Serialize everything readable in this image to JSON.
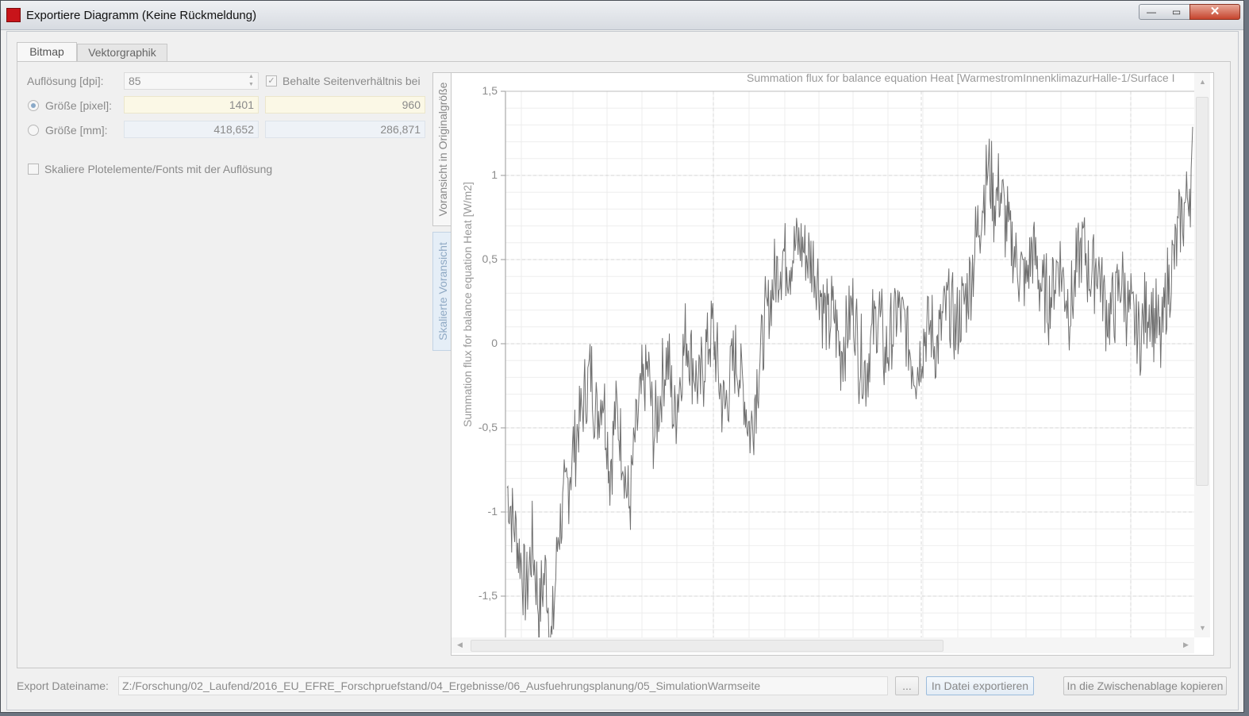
{
  "window": {
    "title": "Exportiere Diagramm (Keine Rückmeldung)",
    "controls": {
      "minimize": "—",
      "maximize": "▭",
      "close": "✕"
    }
  },
  "tabs": [
    {
      "label": "Bitmap",
      "active": true
    },
    {
      "label": "Vektorgraphik",
      "active": false
    }
  ],
  "bitmap": {
    "resolution_label": "Auflösung [dpi]:",
    "resolution_value": "85",
    "keep_aspect_label": "Behalte Seitenverhältnis bei",
    "keep_aspect_checked": true,
    "size_pixel_label": "Größe [pixel]:",
    "size_pixel_selected": true,
    "size_pixel_width": "1401",
    "size_pixel_height": "960",
    "size_mm_label": "Größe [mm]:",
    "size_mm_width": "418,652",
    "size_mm_height": "286,871",
    "scale_fonts_label": "Skaliere Plotelemente/Fonts mit der Auflösung",
    "scale_fonts_checked": false
  },
  "preview_tabs": {
    "original": "Voransicht in Originalgröße",
    "scaled": "Skalierte Voransicht"
  },
  "chart_data": {
    "type": "line",
    "title": "Summation flux for balance equation Heat [WarmestromInnenklimazurHalle-1/Surface I",
    "ylabel": "Summation flux for balance equation Heat [W/m2]",
    "yticks": [
      "1,5",
      "1",
      "0,5",
      "0",
      "-0,5",
      "-1",
      "-1,5"
    ],
    "ylim": [
      -1.75,
      1.5
    ],
    "grid": true,
    "series": [
      {
        "color": "#707070",
        "values": [
          -0.85,
          -1.05,
          -1.25,
          -1.45,
          -1.2,
          -1.6,
          -1.35,
          -1.8,
          -1.1,
          -0.95,
          -0.7,
          -0.5,
          -0.35,
          -0.15,
          -0.45,
          -0.25,
          -0.75,
          -0.4,
          -0.6,
          -1.0,
          -0.55,
          -0.3,
          -0.15,
          -0.55,
          -0.3,
          -0.05,
          -0.45,
          -0.2,
          0.05,
          -0.1,
          -0.3,
          -0.05,
          0.1,
          -0.2,
          -0.4,
          -0.15,
          -0.1,
          -0.3,
          -0.55,
          -0.2,
          0.05,
          0.25,
          0.4,
          0.55,
          0.5,
          0.58,
          0.6,
          0.5,
          0.45,
          0.3,
          0.1,
          0.2,
          -0.05,
          0.1,
          0.25,
          -0.1,
          -0.15,
          0.05,
          0.2,
          -0.1,
          0.05,
          0.2,
          0.1,
          -0.05,
          -0.15,
          0.05,
          0.1,
          -0.05,
          0.15,
          0.25,
          0.05,
          0.2,
          0.35,
          0.55,
          0.8,
          1.05,
          0.85,
          0.9,
          0.7,
          0.55,
          0.45,
          0.35,
          0.6,
          0.4,
          0.25,
          0.3,
          0.5,
          0.35,
          0.2,
          0.45,
          0.6,
          0.4,
          0.5,
          0.3,
          0.15,
          0.25,
          0.4,
          0.2,
          0.1,
          0.05,
          0.25,
          0.15,
          0.0,
          0.3,
          0.5,
          0.7,
          0.85,
          1.05
        ]
      }
    ]
  },
  "footer": {
    "filename_label": "Export Dateiname:",
    "filename_value": "Z:/Forschung/02_Laufend/2016_EU_EFRE_Forschpruefstand/04_Ergebnisse/06_Ausfuehrungsplanung/05_SimulationWarmseite",
    "browse_label": "...",
    "export_label": "In Datei exportieren",
    "clipboard_label": "In die Zwischenablage kopieren"
  }
}
